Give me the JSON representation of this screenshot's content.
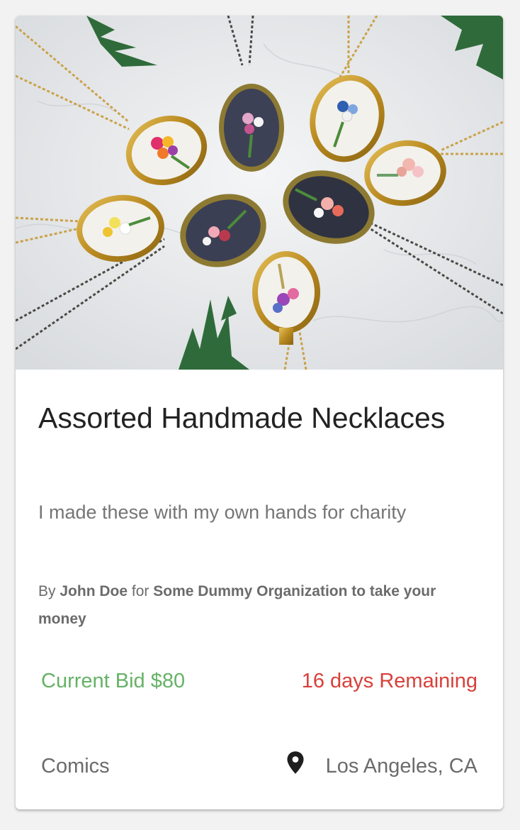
{
  "listing": {
    "image_alt": "Embroidered flower bouquet pendant necklaces arranged in a circle",
    "title": "Assorted Handmade Necklaces",
    "description": "I made these with my own hands for charity",
    "byline": {
      "prefix": "By",
      "author": "John Doe",
      "connector": "for",
      "organization": "Some Dummy Organization to take your money"
    },
    "current_bid": "Current Bid $80",
    "time_remaining": "16 days Remaining",
    "category": "Comics",
    "location": "Los Angeles, CA",
    "location_icon": "map-pin-icon"
  },
  "colors": {
    "bid": "#66b266",
    "remaining": "#d9403a",
    "text_muted": "#757575",
    "title": "#222222"
  }
}
